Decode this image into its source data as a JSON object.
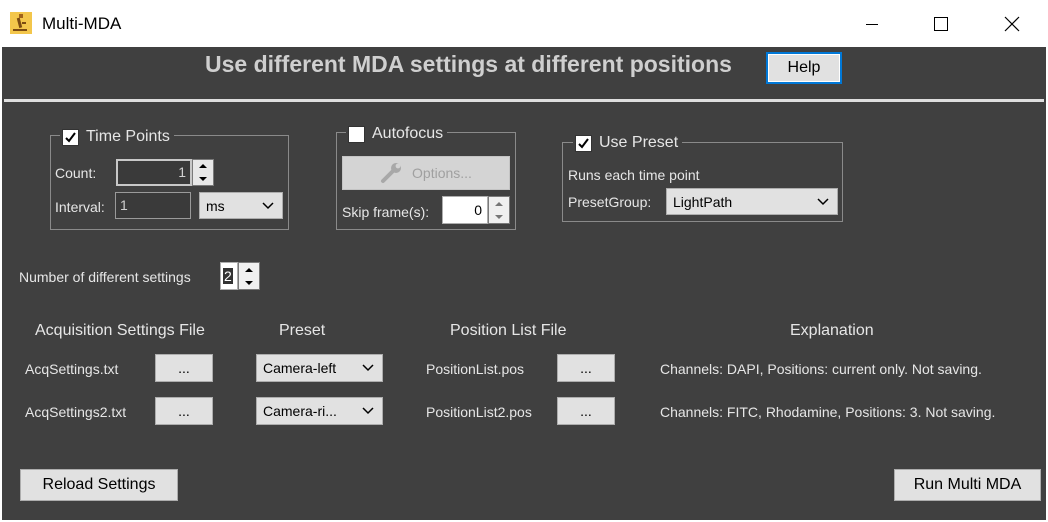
{
  "window": {
    "title": "Multi-MDA",
    "minimize_icon": "minimize-icon",
    "maximize_icon": "maximize-icon",
    "close_icon": "close-icon"
  },
  "header": {
    "title": "Use different MDA settings at different positions",
    "help_label": "Help"
  },
  "time_points": {
    "label": "Time Points",
    "checked": true,
    "count_label": "Count:",
    "count_value": "1",
    "interval_label": "Interval:",
    "interval_value": "1",
    "unit_value": "ms"
  },
  "autofocus": {
    "label": "Autofocus",
    "checked": false,
    "options_label": "Options...",
    "skip_label": "Skip frame(s):",
    "skip_value": "0"
  },
  "use_preset": {
    "label": "Use Preset",
    "checked": true,
    "note": "Runs each time point",
    "group_label": "PresetGroup:",
    "group_value": "LightPath"
  },
  "settings_count": {
    "label": "Number of different settings",
    "value": "2"
  },
  "table": {
    "headers": [
      "Acquisition Settings File",
      "Preset",
      "Position List File",
      "Explanation"
    ],
    "browse_label": "...",
    "rows": [
      {
        "acq_file": "AcqSettings.txt",
        "preset": "Camera-left",
        "pos_file": "PositionList.pos",
        "explanation": "Channels: DAPI, Positions: current only. Not saving."
      },
      {
        "acq_file": "AcqSettings2.txt",
        "preset": "Camera-ri...",
        "pos_file": "PositionList2.pos",
        "explanation": "Channels: FITC, Rhodamine, Positions: 3. Not saving."
      }
    ]
  },
  "footer": {
    "reload_label": "Reload Settings",
    "run_label": "Run Multi MDA"
  },
  "colors": {
    "background": "#404040",
    "text": "#e6e6e6",
    "button": "#e1e1e1",
    "focus": "#0078d7"
  }
}
